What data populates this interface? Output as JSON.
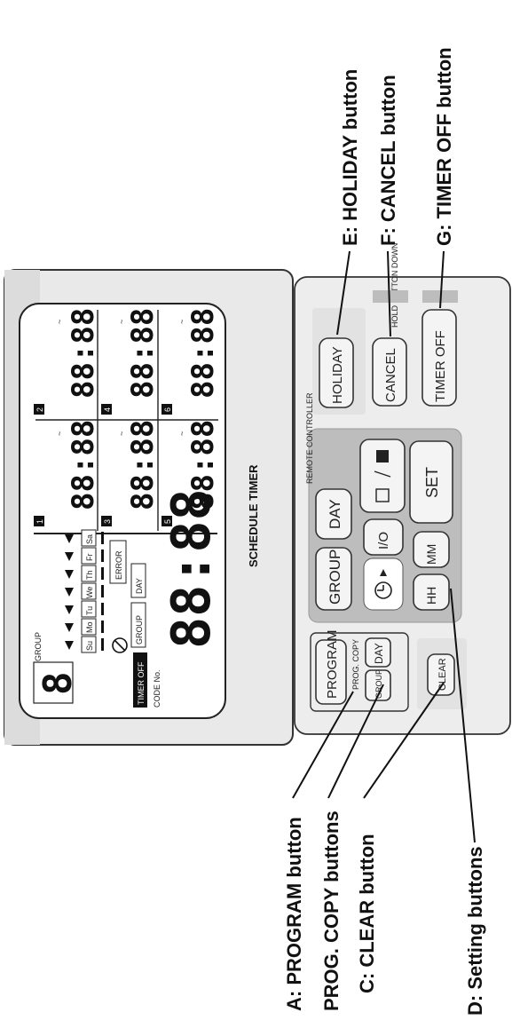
{
  "callouts": {
    "a": "A: PROGRAM button",
    "b": "PROG. COPY buttons",
    "c": "C: CLEAR button",
    "d": "D: Setting buttons",
    "e": "E: HOLIDAY button",
    "f": "F: CANCEL button",
    "g": "G: TIMER OFF button"
  },
  "panel": {
    "title": "SCHEDULE TIMER",
    "lcd": {
      "group_label": "GROUP",
      "group_digit": "8",
      "days": [
        "Su",
        "Mo",
        "Tu",
        "We",
        "Th",
        "Fr",
        "Sa"
      ],
      "error": "ERROR",
      "timer_off": "TIMER OFF",
      "code_no": "CODE No.",
      "group_box": "GROUP",
      "day_box": "DAY",
      "clock": "88:88",
      "slot_numbers": [
        "1",
        "2",
        "3",
        "4",
        "5",
        "6"
      ],
      "slot_time": "88:88",
      "slot_tilde": "~"
    },
    "buttons": {
      "program": "PROGRAM",
      "prog_copy": "PROG. COPY",
      "group_small": "GROUP",
      "day_small": "DAY",
      "clear": "CLEAR",
      "group": "GROUP",
      "day": "DAY",
      "remote_controller": "REMOTE CONTROLLER",
      "on_off": "I/O",
      "set": "SET",
      "hh": "HH",
      "mm": "MM",
      "holiday": "HOLIDAY",
      "cancel": "CANCEL",
      "hold_button_down": "HOLD BUTTON DOWN",
      "timer_off": "TIMER OFF"
    }
  }
}
